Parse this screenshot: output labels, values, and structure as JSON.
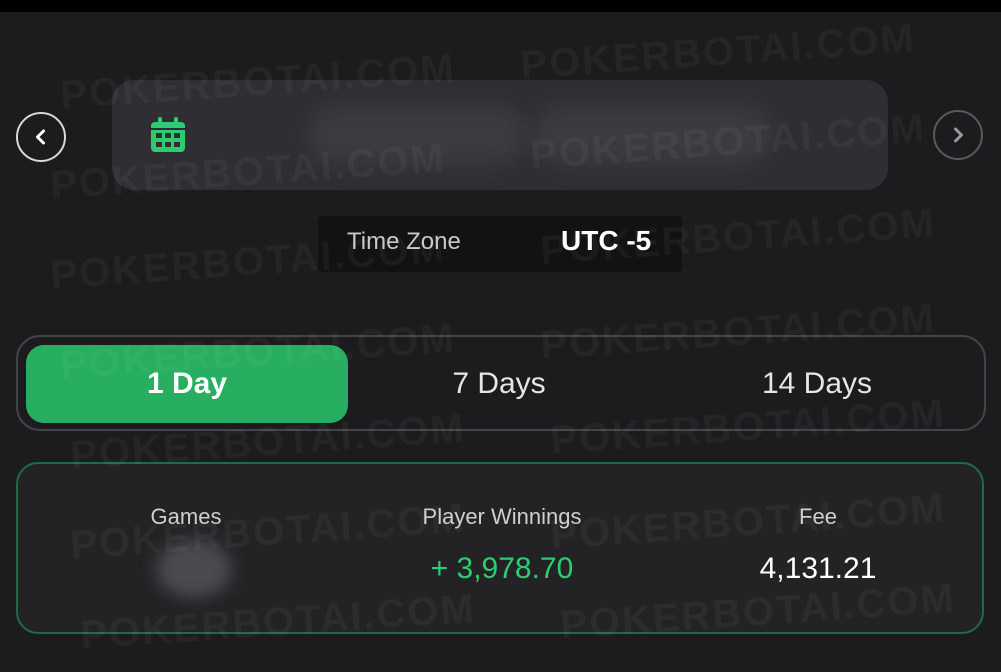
{
  "date_selector": {
    "prev_icon": "chevron-left-icon",
    "next_icon": "chevron-right-icon",
    "calendar_icon": "calendar-icon",
    "date_range_text": ""
  },
  "time_zone": {
    "label": "Time Zone",
    "value": "UTC -5"
  },
  "range_tabs": [
    {
      "label": "1 Day",
      "selected": true
    },
    {
      "label": "7 Days",
      "selected": false
    },
    {
      "label": "14 Days",
      "selected": false
    }
  ],
  "stats": {
    "games": {
      "label": "Games",
      "value": ""
    },
    "player_winnings": {
      "label": "Player Winnings",
      "value": "+ 3,978.70"
    },
    "fee": {
      "label": "Fee",
      "value": "4,131.21"
    }
  },
  "watermark": "POKERBOTAI.COM",
  "colors": {
    "background": "#1c1c1e",
    "accent_green": "#27ae60",
    "winnings_green": "#2ecc71",
    "card_border": "#1f6b47"
  }
}
